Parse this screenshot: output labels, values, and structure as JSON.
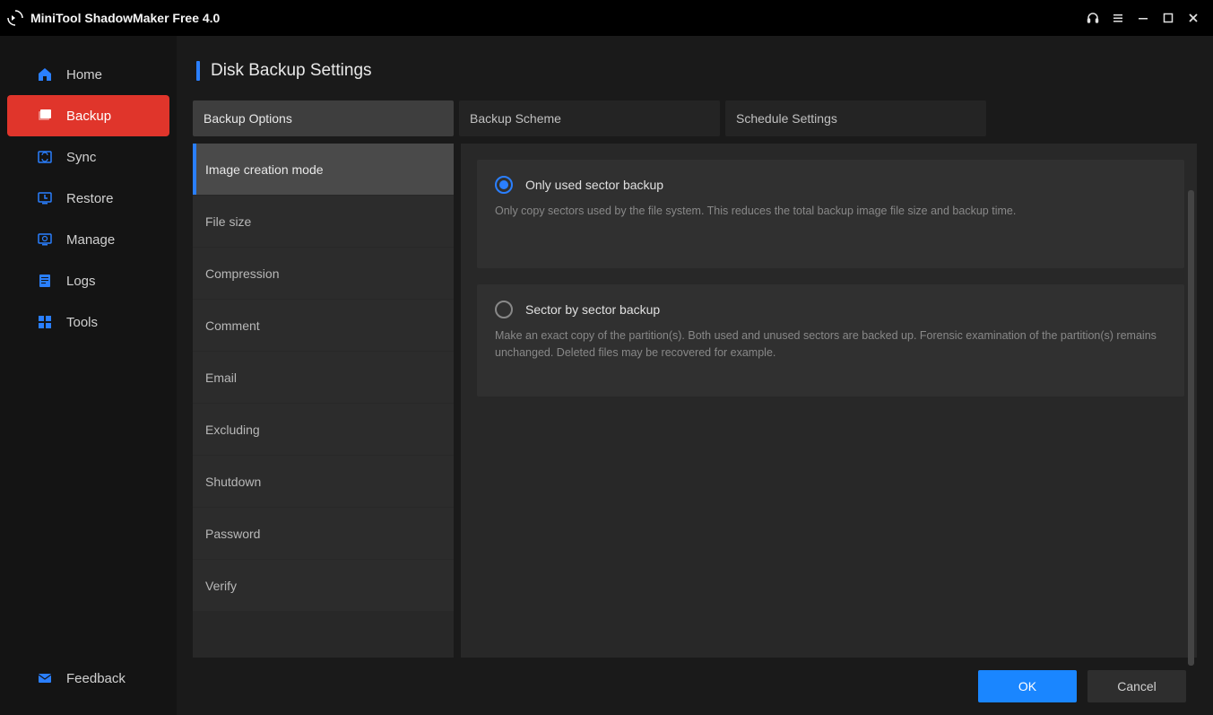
{
  "titlebar": {
    "title": "MiniTool ShadowMaker Free 4.0"
  },
  "sidebar": {
    "items": [
      {
        "label": "Home",
        "icon": "home"
      },
      {
        "label": "Backup",
        "icon": "backup",
        "active": true
      },
      {
        "label": "Sync",
        "icon": "sync"
      },
      {
        "label": "Restore",
        "icon": "restore"
      },
      {
        "label": "Manage",
        "icon": "manage"
      },
      {
        "label": "Logs",
        "icon": "logs"
      },
      {
        "label": "Tools",
        "icon": "tools"
      }
    ],
    "feedback": "Feedback"
  },
  "page": {
    "title": "Disk Backup Settings"
  },
  "tabs": [
    {
      "label": "Backup Options",
      "active": true
    },
    {
      "label": "Backup Scheme"
    },
    {
      "label": "Schedule Settings"
    }
  ],
  "options": [
    {
      "label": "Image creation mode",
      "active": true
    },
    {
      "label": "File size"
    },
    {
      "label": "Compression"
    },
    {
      "label": "Comment"
    },
    {
      "label": "Email"
    },
    {
      "label": "Excluding"
    },
    {
      "label": "Shutdown"
    },
    {
      "label": "Password"
    },
    {
      "label": "Verify"
    }
  ],
  "radios": [
    {
      "label": "Only used sector backup",
      "desc": "Only copy sectors used by the file system. This reduces the total backup image file size and backup time.",
      "selected": true
    },
    {
      "label": "Sector by sector backup",
      "desc": "Make an exact copy of the partition(s). Both used and unused sectors are backed up. Forensic examination of the partition(s) remains unchanged. Deleted files may be recovered for example.",
      "selected": false
    }
  ],
  "buttons": {
    "ok": "OK",
    "cancel": "Cancel"
  }
}
